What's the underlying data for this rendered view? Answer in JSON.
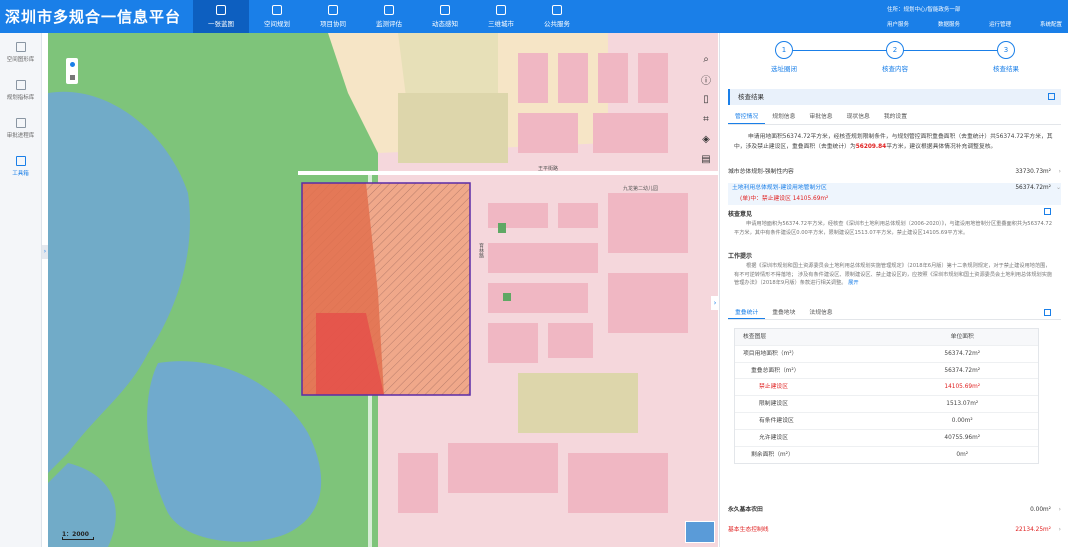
{
  "app": {
    "title": "深圳市多规合一信息平台"
  },
  "nav": [
    {
      "label": "一张蓝图",
      "active": true
    },
    {
      "label": "空间规划"
    },
    {
      "label": "项目协同"
    },
    {
      "label": "监测评估"
    },
    {
      "label": "动态感知"
    },
    {
      "label": "三维城市"
    },
    {
      "label": "公共服务"
    }
  ],
  "header": {
    "user": "住所：规划中心/智能政务一部",
    "links": [
      "用户服务",
      "数据服务",
      "运行管理",
      "系统配置"
    ]
  },
  "sidebar": [
    {
      "label": "空间图形库"
    },
    {
      "label": "规划指标库"
    },
    {
      "label": "审批进程库"
    },
    {
      "label": "工具箱",
      "active": true
    }
  ],
  "map": {
    "road_label_1": "王平街路",
    "road_label_2": "育林路",
    "poi_label": "九龙第二幼儿园",
    "scale": "1：2000"
  },
  "steps": [
    {
      "num": "1",
      "label": "选址圈闭"
    },
    {
      "num": "2",
      "label": "核查内容"
    },
    {
      "num": "3",
      "label": "核查结果"
    }
  ],
  "panel": {
    "section_title": "核查结果",
    "tabs": [
      "管控情况",
      "规划信息",
      "审批信息",
      "现状信息",
      "我的设置"
    ],
    "summary_pre": "申请用地面积56374.72平方米，经核查规划限制条件，与规划管控面积重叠面积（去重统计）共56374.72平方米，其中，涉及禁止建设区，重叠面积（去重统计）为",
    "summary_highlight": "56209.84",
    "summary_post": "平方米，建议根据具体情况补充调整复核。",
    "row1_label": "城市总体规划-强制性内容",
    "row1_val": "33730.73m²",
    "row2_label": "土地利用总体规划-建设用地管制分区",
    "row2_sub": "(单)中：禁止建设区 14105.69m²",
    "row2_val": "56374.72m²",
    "review_title": "核查意见",
    "review_text": "申请用地面积为56374.72平方米，经核查《深圳市土地利用总体规划（2006-2020）》，与建设用地管制分区重叠面积共为56374.72平方米，其中有条件建设区0.00平方米，限制建设区1513.07平方米，禁止建设区14105.69平方米。",
    "work_title": "工作提示",
    "work_text_1": "根据《深圳市规划和国土资源委员会土地利用总体规划实施管理规定》（2018年6月版）第十二条规则规定，对于禁止建设用地范围，有不可逆转情形不得落地；",
    "work_text_2": "涉及有条件建设区、限制建设区、禁止建设区的，应按照《深圳市规划和国土资源委员会土地利用总体规划实施管理办法》（2018年9月版）条款进行相关调整。",
    "work_link": "展开",
    "tabs2": [
      "重叠统计",
      "重叠地块",
      "法规信息"
    ],
    "table_head": [
      "核查图层",
      "单位面积"
    ],
    "table_rows": [
      {
        "name": "项目用地面积（m²）",
        "value": "56374.72m²"
      },
      {
        "name": "重叠总面积（m²）",
        "value": "56374.72m²"
      },
      {
        "name": "禁止建设区",
        "value": "14105.69m²",
        "red": true
      },
      {
        "name": "限制建设区",
        "value": "1513.07m²"
      },
      {
        "name": "有条件建设区",
        "value": "0.00m²"
      },
      {
        "name": "允许建设区",
        "value": "40755.96m²"
      },
      {
        "name": "剩余面积（m²）",
        "value": "0m²"
      }
    ],
    "foot1_label": "永久基本农田",
    "foot1_val": "0.00m²",
    "foot2_label": "基本生态控制线",
    "foot2_val": "22134.25m²"
  },
  "colors": {
    "primary": "#1a7fe8",
    "alert": "#e02020",
    "map_green": "#7ec47a",
    "building": "#f1c7cf",
    "water": "#5a9bd8"
  }
}
